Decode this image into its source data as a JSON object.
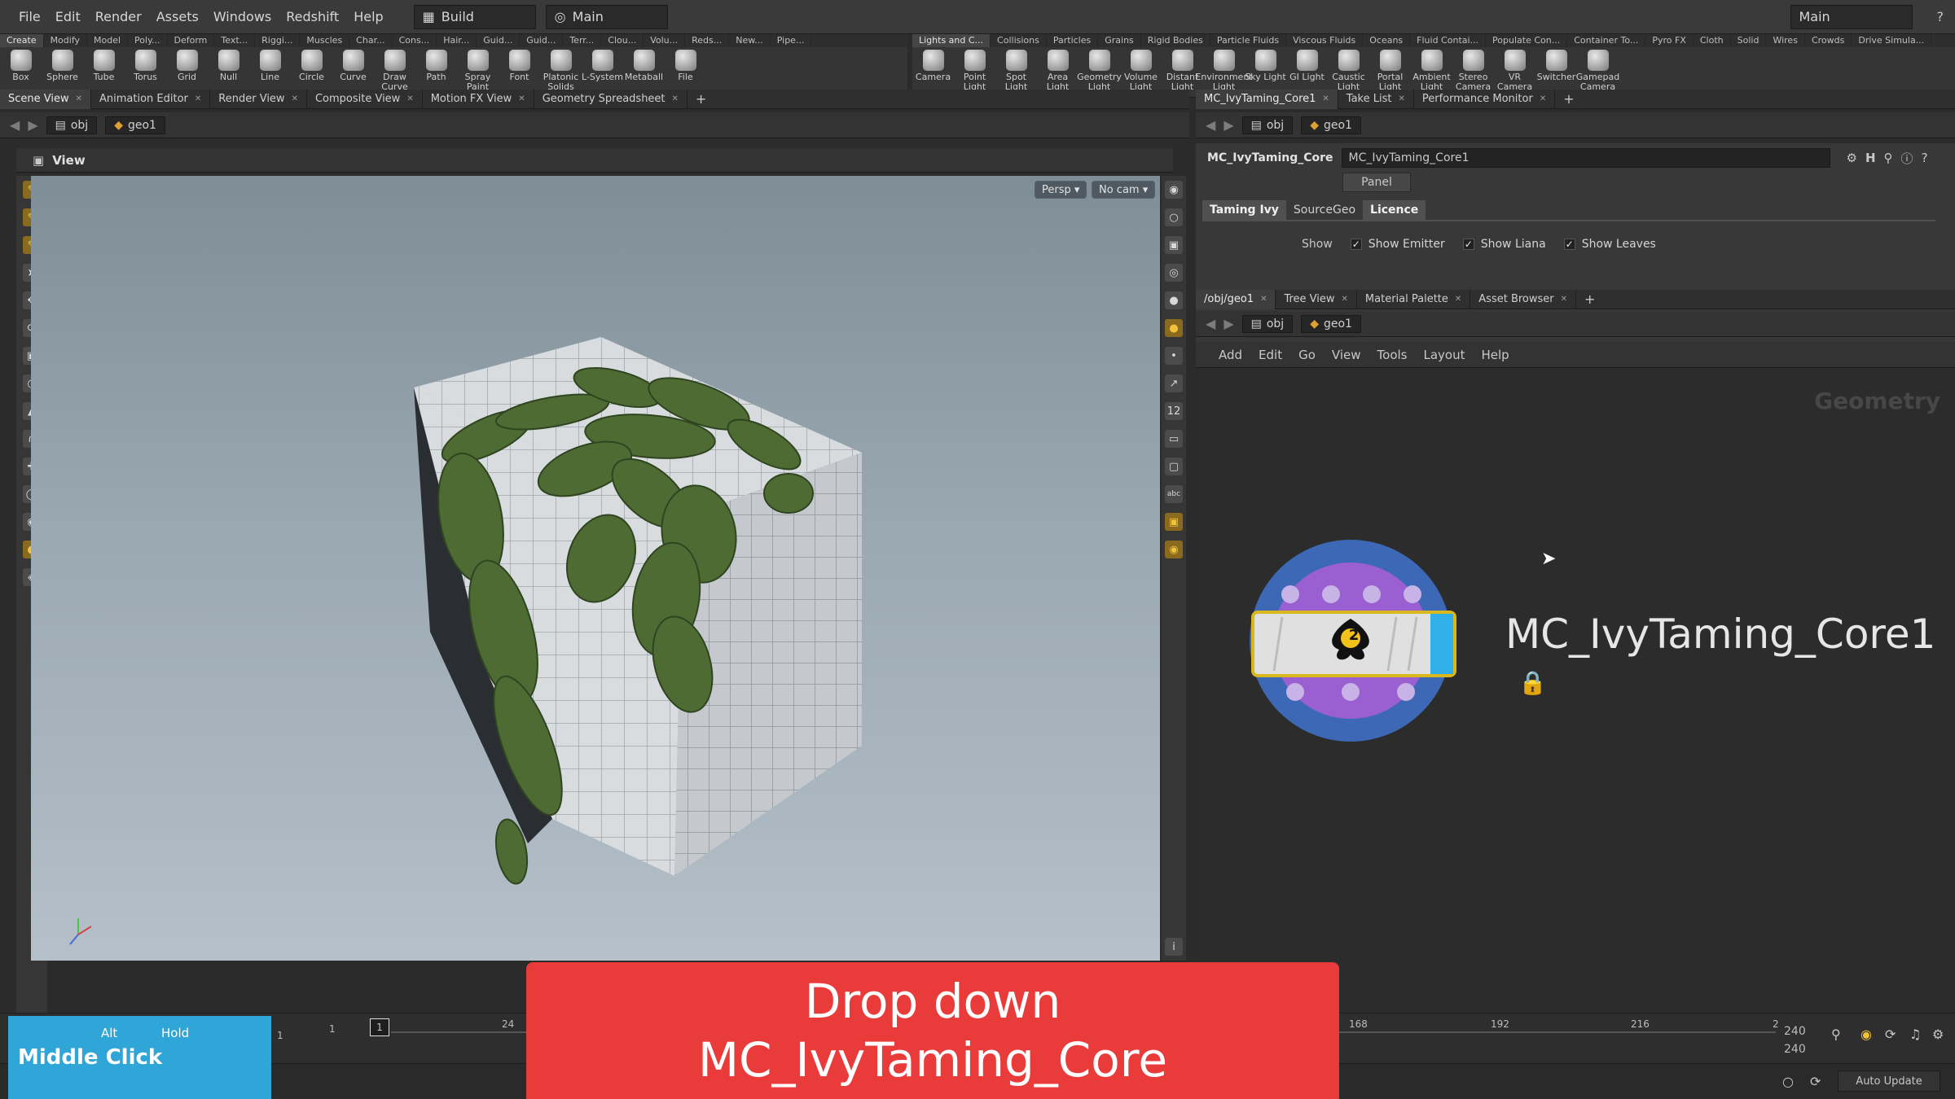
{
  "menu": [
    "File",
    "Edit",
    "Render",
    "Assets",
    "Windows",
    "Redshift",
    "Help"
  ],
  "desktop_left": "Build",
  "desktop_mid": "Main",
  "desktop_right": "Main",
  "shelf_left": {
    "tabs": [
      "Create",
      "Modify",
      "Model",
      "Poly...",
      "Deform",
      "Text...",
      "Riggi...",
      "Muscles",
      "Char...",
      "Cons...",
      "Hair...",
      "Guid...",
      "Guid...",
      "Terr...",
      "Clou...",
      "Volu...",
      "Reds...",
      "New...",
      "Pipe..."
    ],
    "tools": [
      "Box",
      "Sphere",
      "Tube",
      "Torus",
      "Grid",
      "Null",
      "Line",
      "Circle",
      "Curve",
      "Draw Curve",
      "Path",
      "Spray Paint",
      "Font",
      "Platonic Solids",
      "L-System",
      "Metaball",
      "File"
    ]
  },
  "shelf_right": {
    "tabs": [
      "Lights and C...",
      "Collisions",
      "Particles",
      "Grains",
      "Rigid Bodies",
      "Particle Fluids",
      "Viscous Fluids",
      "Oceans",
      "Fluid Contai...",
      "Populate Con...",
      "Container To...",
      "Pyro FX",
      "Cloth",
      "Solid",
      "Wires",
      "Crowds",
      "Drive Simula..."
    ],
    "tools": [
      "Camera",
      "Point Light",
      "Spot Light",
      "Area Light",
      "Geometry Light",
      "Volume Light",
      "Distant Light",
      "Environment Light",
      "Sky Light",
      "GI Light",
      "Caustic Light",
      "Portal Light",
      "Ambient Light",
      "Stereo Camera",
      "VR Camera",
      "Switcher",
      "Gamepad Camera"
    ]
  },
  "left_pane": {
    "tabs": [
      "Scene View",
      "Animation Editor",
      "Render View",
      "Composite View",
      "Motion FX View",
      "Geometry Spreadsheet"
    ],
    "path_obj": "obj",
    "path_geo": "geo1",
    "view_label": "View",
    "persp": "Persp ▾",
    "nocam": "No cam ▾"
  },
  "param_pane": {
    "tabs": [
      "MC_IvyTaming_Core1",
      "Take List",
      "Performance Monitor"
    ],
    "path_obj": "obj",
    "path_geo": "geo1",
    "node_type": "MC_IvyTaming_Core",
    "node_name": "MC_IvyTaming_Core1",
    "panel_btn": "Panel",
    "subtabs": [
      "Taming Ivy",
      "SourceGeo",
      "Licence"
    ],
    "show_label": "Show",
    "toggles": [
      "Show Emitter",
      "Show Liana",
      "Show Leaves"
    ]
  },
  "network_pane": {
    "tabs": [
      "/obj/geo1",
      "Tree View",
      "Material Palette",
      "Asset Browser"
    ],
    "path_obj": "obj",
    "path_geo": "geo1",
    "menu": [
      "Add",
      "Edit",
      "Go",
      "View",
      "Tools",
      "Layout",
      "Help"
    ],
    "context_label": "Geometry",
    "node_label": "MC_IvyTaming_Core1",
    "node_badge": "2"
  },
  "timeline": {
    "frame_start": "1",
    "frame_start2": "1",
    "current_frame": "1",
    "ticks": [
      "24",
      "168",
      "192",
      "216"
    ],
    "frame_end": "240",
    "frame_end2": "240",
    "end_marker": "2",
    "auto_update": "Auto Update"
  },
  "overlay": {
    "key_alt": "Alt",
    "key_hold": "Hold",
    "key_action": "Middle Click",
    "caption_line1": "Drop down",
    "caption_line2": "MC_IvyTaming_Core"
  },
  "colors": {
    "caption_bg": "#ea3b3b",
    "keycast_bg": "#2fa5d8",
    "node_ring": "#3c68b5",
    "node_inner": "#9a5fd0",
    "node_flag": "#2fb0e8"
  }
}
